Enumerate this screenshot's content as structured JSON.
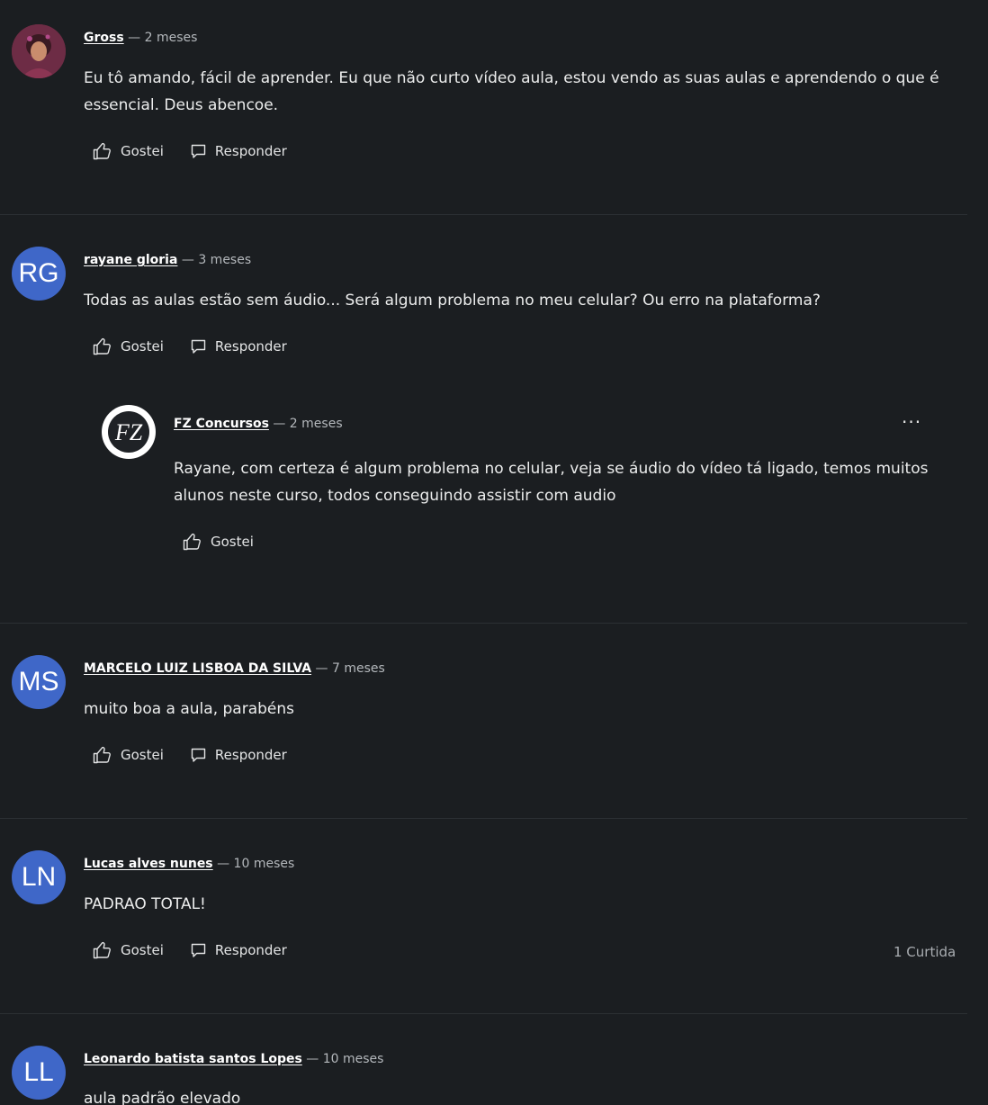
{
  "labels": {
    "like": "Gostei",
    "reply": "Responder",
    "more": "···"
  },
  "comments": [
    {
      "author": "Gross",
      "time": "— 2 meses",
      "text": "Eu tô amando, fácil de aprender. Eu que não curto vídeo aula, estou vendo as suas aulas e aprendendo o que é essencial. Deus abencoe."
    },
    {
      "author": "rayane gloria",
      "initials": "RG",
      "time": "— 3 meses",
      "text": "Todas as aulas estão sem áudio... Será algum problema no meu celular? Ou erro na plataforma?",
      "reply": {
        "author": "FZ Concursos",
        "logo_text": "FZ",
        "time": "— 2 meses",
        "text": "Rayane, com certeza é algum problema no celular, veja se áudio do vídeo tá ligado, temos muitos alunos neste curso, todos conseguindo assistir com audio"
      }
    },
    {
      "author": "MARCELO LUIZ LISBOA DA SILVA",
      "initials": "MS",
      "time": "— 7 meses",
      "text": "muito boa a aula, parabéns"
    },
    {
      "author": "Lucas alves nunes",
      "initials": "LN",
      "time": "— 10 meses",
      "text": "PADRAO TOTAL!",
      "likes": "1 Curtida"
    },
    {
      "author": "Leonardo batista santos Lopes",
      "initials": "LL",
      "time": "— 10 meses",
      "text": "aula padrão elevado"
    }
  ],
  "colors": {
    "background": "#1b1e21",
    "avatar": "#3f67c8",
    "divider": "#2c3034"
  }
}
